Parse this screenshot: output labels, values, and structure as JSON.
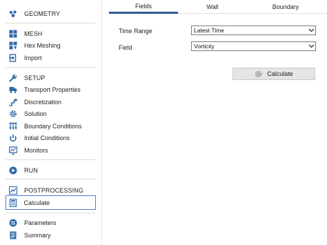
{
  "sidebar": {
    "geometry": "GEOMETRY",
    "mesh": "MESH",
    "hex_meshing": "Hex Meshing",
    "import": "Import",
    "setup": "SETUP",
    "transport_properties": "Transport Properties",
    "discretization": "Discretization",
    "solution": "Solution",
    "boundary_conditions": "Boundary Conditions",
    "initial_conditions": "Initial Conditions",
    "monitors": "Monitors",
    "run": "RUN",
    "postprocessing": "POSTPROCESSING",
    "calculate": "Calculate",
    "parameters": "Parameters",
    "summary": "Summary"
  },
  "tabs": {
    "fields": "Fields",
    "wall": "Wall",
    "boundary": "Boundary"
  },
  "form": {
    "time_range_label": "Time Range",
    "time_range_value": "Latest Time",
    "field_label": "Field",
    "field_value": "Vorticity",
    "calculate_button": "Calculate"
  },
  "colors": {
    "icon": "#2f6aa8",
    "selected_border": "#4a79d8",
    "active_tab": "#2c5a9a"
  }
}
